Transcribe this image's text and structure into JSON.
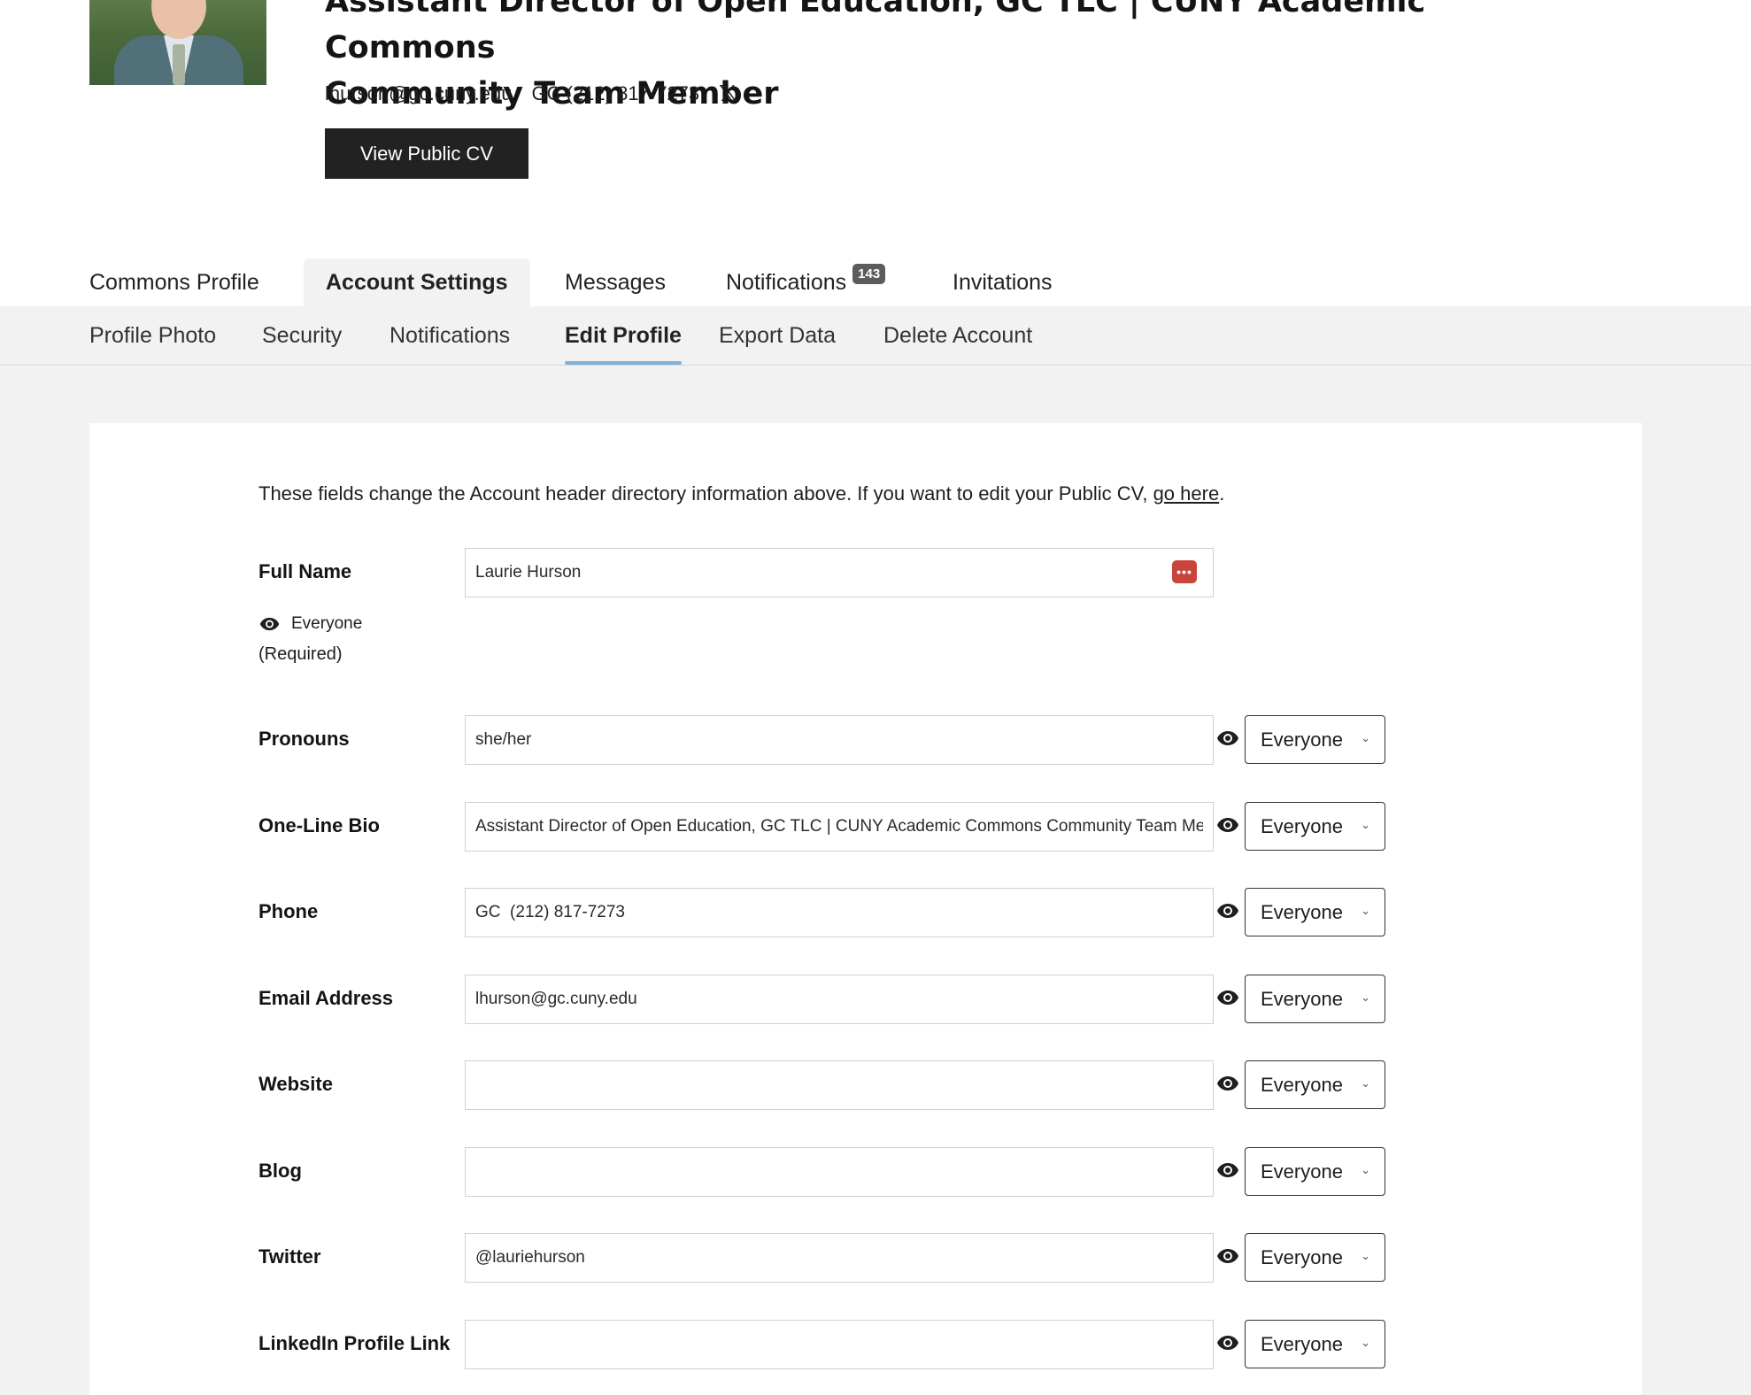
{
  "header": {
    "title_line1": "Assistant Director of Open Education, GC TLC | CUNY Academic Commons",
    "title_line2": "Community Team Member",
    "email": "lhurson@gc.cuny.edu",
    "phone": "GC (212) 817-7273",
    "social_icon": "x-twitter-icon",
    "cv_button": "View Public CV"
  },
  "primary_tabs": [
    {
      "label": "Commons Profile",
      "active": false
    },
    {
      "label": "Account Settings",
      "active": true
    },
    {
      "label": "Messages",
      "active": false
    },
    {
      "label": "Notifications",
      "active": false,
      "badge": "143"
    },
    {
      "label": "Invitations",
      "active": false
    }
  ],
  "sub_tabs": [
    {
      "label": "Profile Photo",
      "active": false
    },
    {
      "label": "Security",
      "active": false
    },
    {
      "label": "Notifications",
      "active": false
    },
    {
      "label": "Edit Profile",
      "active": true
    },
    {
      "label": "Export Data",
      "active": false
    },
    {
      "label": "Delete Account",
      "active": false
    }
  ],
  "intro": {
    "text": "These fields change the Account header directory information above. If you want to edit your Public CV, ",
    "link": "go here",
    "end": "."
  },
  "full_name": {
    "label": "Full Name",
    "value": "Laurie Hurson",
    "visibility": "Everyone",
    "required": "(Required)"
  },
  "fields": [
    {
      "label": "Pronouns",
      "value": "she/her",
      "visibility": "Everyone"
    },
    {
      "label": "One-Line Bio",
      "value": "Assistant Director of Open Education, GC TLC | CUNY Academic Commons Community Team Member",
      "visibility": "Everyone"
    },
    {
      "label": "Phone",
      "value": "GC  (212) 817-7273",
      "visibility": "Everyone"
    },
    {
      "label": "Email Address",
      "value": "lhurson@gc.cuny.edu",
      "visibility": "Everyone"
    },
    {
      "label": "Website",
      "value": "",
      "visibility": "Everyone"
    },
    {
      "label": "Blog",
      "value": "",
      "visibility": "Everyone"
    },
    {
      "label": "Twitter",
      "value": "@lauriehurson",
      "visibility": "Everyone"
    },
    {
      "label": "LinkedIn Profile Link",
      "value": "",
      "visibility": "Everyone"
    }
  ],
  "colors": {
    "accent_underline": "#7fb3dd",
    "button_dark": "#222222",
    "password_manager_icon": "#c9443a",
    "badge": "#5c5c5c"
  }
}
